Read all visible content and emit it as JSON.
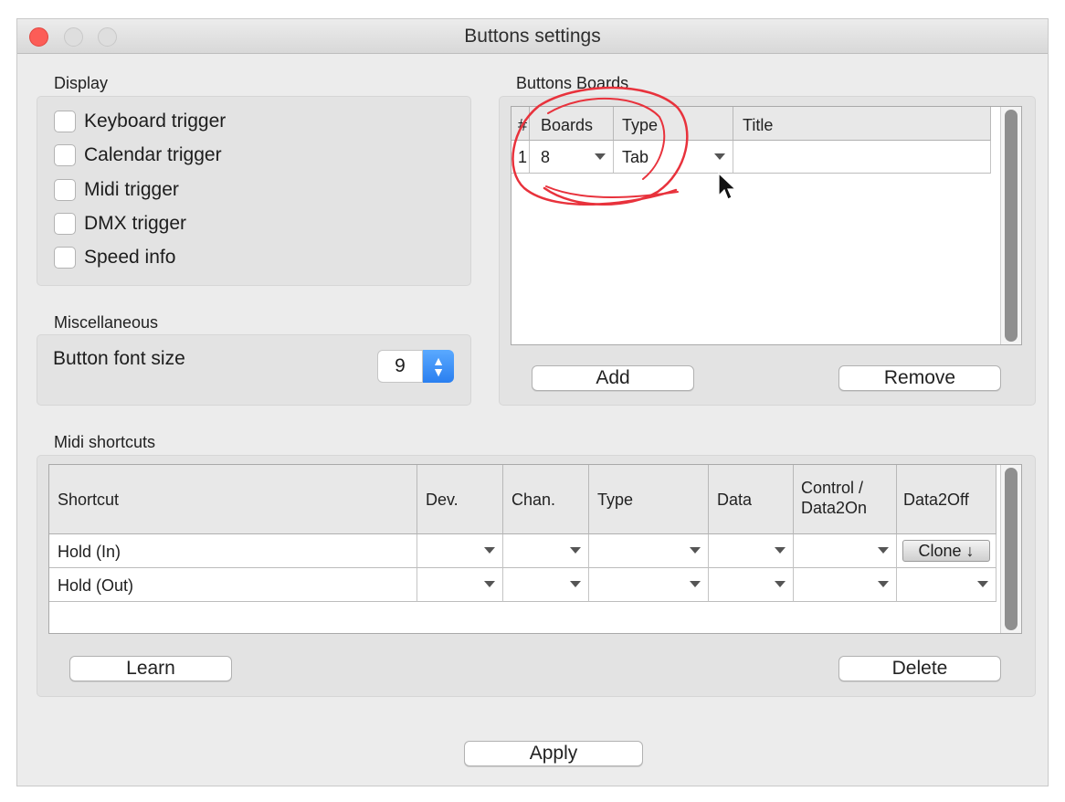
{
  "window": {
    "title": "Buttons settings"
  },
  "display": {
    "label": "Display",
    "options": [
      {
        "label": "Keyboard trigger",
        "checked": false
      },
      {
        "label": "Calendar trigger",
        "checked": false
      },
      {
        "label": "Midi trigger",
        "checked": false
      },
      {
        "label": "DMX trigger",
        "checked": false
      },
      {
        "label": "Speed info",
        "checked": false
      }
    ]
  },
  "misc": {
    "label": "Miscellaneous",
    "font_size_label": "Button font size",
    "font_size_value": "9"
  },
  "boards": {
    "label": "Buttons Boards",
    "columns": [
      "#",
      "Boards",
      "Type",
      "Title"
    ],
    "rows": [
      {
        "num": "1",
        "boards": "8",
        "type": "Tab",
        "title": ""
      }
    ],
    "add_label": "Add",
    "remove_label": "Remove"
  },
  "midi": {
    "label": "Midi shortcuts",
    "columns": [
      "Shortcut",
      "Dev.",
      "Chan.",
      "Type",
      "Data",
      "Control / Data2On",
      "Data2Off"
    ],
    "col_control_1": "Control /",
    "col_control_2": "Data2On",
    "rows": [
      {
        "shortcut": "Hold (In)",
        "data2off": "Clone ↓"
      },
      {
        "shortcut": "Hold (Out)",
        "data2off": ""
      }
    ],
    "learn_label": "Learn",
    "delete_label": "Delete"
  },
  "apply_label": "Apply",
  "colors": {
    "accent": "#2a7ff0",
    "close": "#fc5d57",
    "annotation": "#e8323c"
  }
}
